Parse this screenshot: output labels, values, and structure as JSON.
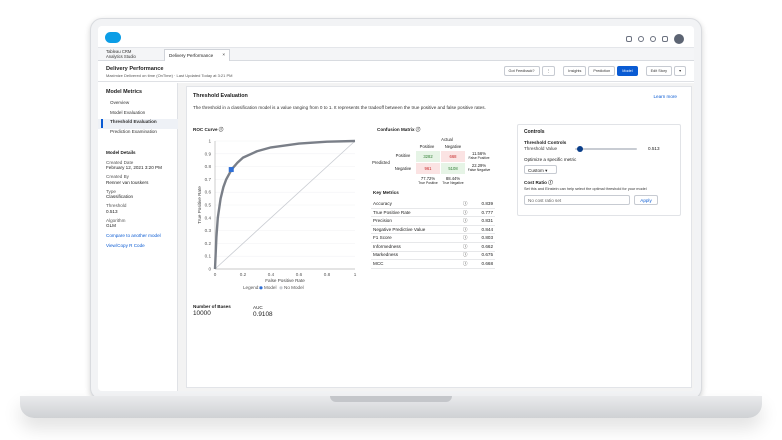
{
  "app": {
    "name_line1": "Tableau CRM",
    "name_line2": "Analytics Studio"
  },
  "tab": {
    "label": "Delivery Performance",
    "close": "×"
  },
  "header": {
    "title": "Delivery Performance",
    "subtitle": "Maximize Delivered on time (OnTime) · Last Updated Today at 3:21 PM",
    "buttons": [
      "Got Feedback?",
      "⋮",
      "Insights",
      "Prediction",
      "Model",
      "Edit Story",
      "▾"
    ]
  },
  "sidebar": {
    "title": "Model Metrics",
    "nav": [
      "Overview",
      "Model Evaluation",
      "Threshold Evaluation",
      "Prediction Examination"
    ],
    "details_title": "Model Details",
    "created_date_label": "Created Date",
    "created_date": "February 12, 2021 3:20 PM",
    "created_by_label": "Created By",
    "created_by": "Renner van touskers",
    "type_label": "Type",
    "type": "Classification",
    "threshold_label": "Threshold",
    "threshold": "0.513",
    "algorithm_label": "Algorithm",
    "algorithm": "GLM",
    "compare_link": "Compare to another model",
    "view_link": "View/Copy R Code"
  },
  "main": {
    "title": "Threshold Evaluation",
    "description": "The threshold in a classification model is a value ranging from 0 to 1. It represents the tradeoff between the true positive and false positive rates.",
    "learn_more": "Learn more",
    "roc_title": "ROC Curve",
    "bases_label": "Number of Bases",
    "bases_value": "10000",
    "auc_label": "AUC",
    "auc_value": "0.9108"
  },
  "confusion": {
    "title": "Confusion Matrix",
    "actual": "Actual",
    "positive": "Positive",
    "negative": "Negative",
    "predicted": "Predicted",
    "tp": "3282",
    "fp": "668",
    "fn": "961",
    "tn": "5108",
    "fpr": "11.56%",
    "fpr_label": "False Positive",
    "fnr": "22.29%",
    "fnr_label": "False Negative",
    "tpr": "77.72%",
    "tpr_label": "True Positive",
    "tnr": "88.44%",
    "tnr_label": "True Negative",
    "colors": {
      "tp": "#e6f4e6",
      "fp": "#fbe3e3",
      "fn": "#fbe3e3",
      "tn": "#e6f4e6"
    }
  },
  "key_metrics": {
    "title": "Key Metrics",
    "rows": [
      {
        "name": "Accuracy",
        "mark": "ⓘ",
        "value": "0.839"
      },
      {
        "name": "True Positive Rate",
        "mark": "ⓘ",
        "value": "0.777"
      },
      {
        "name": "Precision",
        "mark": "ⓘ",
        "value": "0.831"
      },
      {
        "name": "Negative Predictive Value",
        "mark": "ⓘ",
        "value": "0.844"
      },
      {
        "name": "F1 Score",
        "mark": "ⓘ",
        "value": "0.803"
      },
      {
        "name": "Informedness",
        "mark": "ⓘ",
        "value": "0.662"
      },
      {
        "name": "Markedness",
        "mark": "ⓘ",
        "value": "0.675"
      },
      {
        "name": "MCC",
        "mark": "ⓘ",
        "value": "0.668"
      }
    ]
  },
  "controls": {
    "title": "Controls",
    "subtitle": "Threshold Controls",
    "threshold_label": "Threshold Value",
    "threshold_value": "0.513",
    "slider_fraction": 0.513,
    "optimize_label": "Optimize a specific metric",
    "optimize_value": "Custom",
    "cost_title": "Cost Ratio",
    "cost_desc": "Set this and Einstein can help select the optimal threshold for your model",
    "cost_placeholder": "No cost ratio set",
    "apply": "Apply"
  },
  "chart_data": {
    "type": "line",
    "xlabel": "False Positive Rate",
    "ylabel": "True Positive Rate",
    "xlim": [
      0,
      1
    ],
    "ylim": [
      0,
      1
    ],
    "x_ticks": [
      "0",
      "0.2",
      "0.4",
      "0.6",
      "0.8",
      "1"
    ],
    "y_ticks": [
      "0",
      "0.1",
      "0.2",
      "0.3",
      "0.4",
      "0.5",
      "0.6",
      "0.7",
      "0.8",
      "0.9",
      "1"
    ],
    "legend": [
      "Legend:",
      "Model",
      "No Model"
    ],
    "series": [
      {
        "name": "Model",
        "x": [
          0,
          0.01,
          0.02,
          0.04,
          0.06,
          0.08,
          0.1,
          0.12,
          0.16,
          0.2,
          0.3,
          0.4,
          0.6,
          0.8,
          1
        ],
        "y": [
          0,
          0.25,
          0.4,
          0.55,
          0.64,
          0.7,
          0.74,
          0.78,
          0.83,
          0.87,
          0.92,
          0.95,
          0.98,
          0.995,
          1
        ]
      },
      {
        "name": "No Model",
        "x": [
          0,
          1
        ],
        "y": [
          0,
          1
        ]
      }
    ],
    "marker": {
      "x": 0.116,
      "y": 0.777
    },
    "colors": {
      "model": "#7a7f88",
      "no_model": "#c9ccd2",
      "marker": "#2f6fd6"
    }
  }
}
